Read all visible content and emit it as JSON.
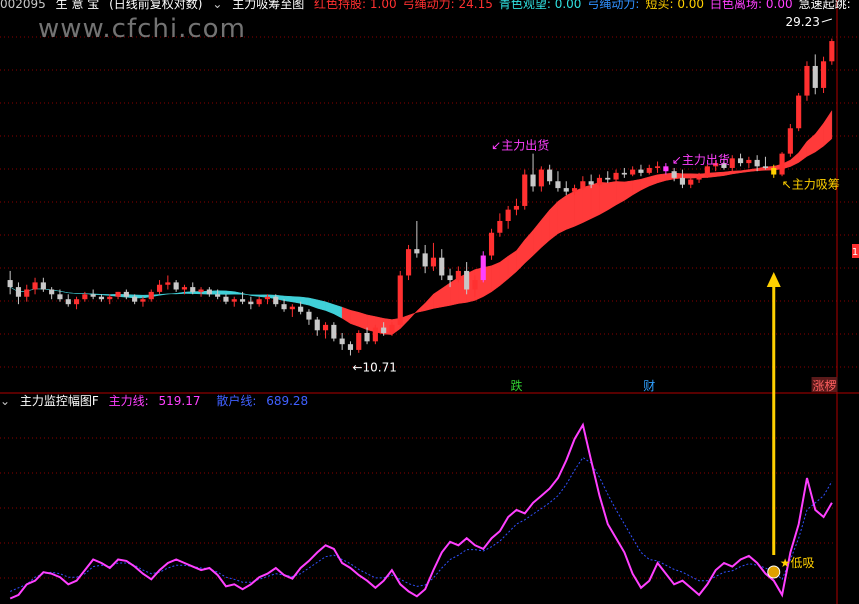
{
  "header": {
    "code": "002095",
    "name": "生 意 宝",
    "mode": "(日线前复权对数)",
    "indicator": "主力吸筹至图",
    "items": [
      {
        "label": "红色持股",
        "value": "1.00",
        "color": "#ff3030"
      },
      {
        "label": "弓绳动力",
        "value": "24.15",
        "color": "#ff3030"
      },
      {
        "label": "青色观望",
        "value": "0.00",
        "color": "#30e0e0"
      },
      {
        "label": "弓绳动力",
        "value": "",
        "color": "#3090ff"
      },
      {
        "label": "短买",
        "value": "0.00",
        "color": "#ffd000"
      },
      {
        "label": "白色离场",
        "value": "0.00",
        "color": "#ff40ff"
      },
      {
        "label": "急速起跳",
        "value": "",
        "color": "#ffffff"
      }
    ]
  },
  "watermark": "www.cfchi.com",
  "sub_header": {
    "title": "主力监控幅图F",
    "line1_label": "主力线:",
    "line1_value": "519.17",
    "line2_label": "散户线:",
    "line2_value": "689.28"
  },
  "annotations": {
    "high_label": "29.23",
    "low_label": "10.71",
    "chuhuo_1": "主力出货",
    "chuhuo_2": "主力出货",
    "xichou": "主力吸筹",
    "dixi": "低吸",
    "right_edge_mark": "1",
    "marker_die": "跌",
    "marker_cai": "财",
    "marker_zhangting": "涨椤"
  },
  "colors": {
    "up": "#ff3030",
    "down": "#c8c8c8",
    "ribbon_red": "#ff3a3a",
    "ribbon_cyan": "#40d0d8",
    "magenta": "#ff40ff",
    "blue_dash": "#3050ff",
    "yellow": "#ffd000",
    "grid": "#8a0000"
  },
  "chart_data": [
    {
      "type": "candlestick",
      "title": "主力吸筹至图",
      "annotations": [
        "29.23",
        "10.71",
        "主力出货",
        "主力出货",
        "主力吸筹"
      ],
      "candles": [
        [
          13.6,
          14.0,
          13.0,
          13.3
        ],
        [
          13.3,
          13.5,
          12.6,
          12.9
        ],
        [
          12.9,
          13.4,
          12.7,
          13.2
        ],
        [
          13.2,
          13.7,
          13.0,
          13.5
        ],
        [
          13.5,
          13.7,
          13.1,
          13.2
        ],
        [
          13.2,
          13.3,
          12.8,
          13.0
        ],
        [
          13.0,
          13.2,
          12.7,
          12.8
        ],
        [
          12.8,
          13.0,
          12.5,
          12.6
        ],
        [
          12.6,
          12.9,
          12.4,
          12.8
        ],
        [
          12.8,
          13.1,
          12.7,
          13.0
        ],
        [
          13.0,
          13.2,
          12.8,
          12.9
        ],
        [
          12.9,
          13.0,
          12.7,
          12.8
        ],
        [
          12.8,
          13.0,
          12.6,
          12.9
        ],
        [
          12.9,
          13.1,
          12.8,
          13.1
        ],
        [
          13.1,
          13.2,
          12.8,
          12.9
        ],
        [
          12.9,
          13.0,
          12.6,
          12.7
        ],
        [
          12.7,
          12.9,
          12.5,
          12.8
        ],
        [
          12.8,
          13.2,
          12.7,
          13.1
        ],
        [
          13.1,
          13.6,
          13.0,
          13.4
        ],
        [
          13.4,
          13.8,
          13.2,
          13.5
        ],
        [
          13.5,
          13.6,
          13.1,
          13.2
        ],
        [
          13.2,
          13.4,
          13.0,
          13.3
        ],
        [
          13.3,
          13.5,
          13.0,
          13.1
        ],
        [
          13.1,
          13.3,
          12.9,
          13.2
        ],
        [
          13.2,
          13.3,
          12.9,
          13.0
        ],
        [
          13.0,
          13.2,
          12.8,
          12.9
        ],
        [
          12.9,
          13.0,
          12.6,
          12.7
        ],
        [
          12.7,
          12.9,
          12.5,
          12.8
        ],
        [
          12.8,
          13.1,
          12.6,
          12.7
        ],
        [
          12.7,
          12.9,
          12.4,
          12.6
        ],
        [
          12.6,
          12.9,
          12.5,
          12.8
        ],
        [
          12.8,
          13.0,
          12.6,
          12.9
        ],
        [
          12.9,
          13.0,
          12.5,
          12.6
        ],
        [
          12.6,
          12.8,
          12.3,
          12.4
        ],
        [
          12.4,
          12.6,
          12.1,
          12.5
        ],
        [
          12.5,
          12.7,
          12.2,
          12.3
        ],
        [
          12.3,
          12.4,
          11.8,
          12.0
        ],
        [
          12.0,
          12.1,
          11.4,
          11.6
        ],
        [
          11.6,
          11.9,
          11.3,
          11.8
        ],
        [
          11.8,
          11.9,
          11.2,
          11.3
        ],
        [
          11.3,
          11.5,
          10.9,
          11.1
        ],
        [
          11.1,
          11.2,
          10.71,
          10.9
        ],
        [
          10.9,
          11.6,
          10.8,
          11.5
        ],
        [
          11.5,
          11.7,
          11.1,
          11.2
        ],
        [
          11.2,
          11.8,
          11.1,
          11.7
        ],
        [
          11.7,
          11.9,
          11.4,
          11.5
        ],
        [
          11.5,
          11.9,
          11.4,
          11.8
        ],
        [
          11.8,
          14.0,
          11.7,
          13.8
        ],
        [
          13.8,
          15.2,
          13.6,
          15.0
        ],
        [
          15.0,
          16.4,
          14.6,
          14.8
        ],
        [
          14.8,
          15.2,
          13.9,
          14.2
        ],
        [
          14.2,
          15.3,
          14.0,
          14.6
        ],
        [
          14.6,
          15.0,
          13.6,
          13.8
        ],
        [
          13.8,
          14.1,
          13.3,
          13.6
        ],
        [
          13.6,
          14.2,
          13.5,
          14.0
        ],
        [
          14.0,
          14.4,
          13.0,
          13.2
        ],
        [
          13.2,
          13.8,
          12.9,
          13.6
        ],
        [
          13.6,
          14.9,
          13.5,
          14.7
        ],
        [
          14.7,
          16.0,
          14.5,
          15.8
        ],
        [
          15.8,
          16.8,
          15.6,
          16.4
        ],
        [
          16.4,
          17.2,
          16.0,
          17.0
        ],
        [
          17.0,
          17.6,
          16.7,
          17.2
        ],
        [
          17.2,
          19.3,
          17.0,
          19.0
        ],
        [
          19.0,
          20.3,
          18.0,
          18.3
        ],
        [
          18.3,
          19.5,
          18.0,
          19.3
        ],
        [
          19.3,
          19.6,
          18.4,
          18.6
        ],
        [
          18.6,
          19.2,
          18.0,
          18.2
        ],
        [
          18.2,
          18.6,
          17.8,
          18.0
        ],
        [
          18.0,
          18.4,
          17.8,
          18.2
        ],
        [
          18.2,
          18.9,
          18.1,
          18.6
        ],
        [
          18.6,
          19.0,
          18.2,
          18.4
        ],
        [
          18.4,
          19.0,
          18.3,
          18.8
        ],
        [
          18.8,
          19.2,
          18.5,
          18.7
        ],
        [
          18.7,
          19.3,
          18.6,
          19.1
        ],
        [
          19.1,
          19.4,
          18.8,
          19.0
        ],
        [
          19.0,
          19.5,
          18.9,
          19.3
        ],
        [
          19.3,
          19.6,
          18.9,
          19.1
        ],
        [
          19.1,
          19.6,
          19.0,
          19.4
        ],
        [
          19.4,
          19.8,
          19.1,
          19.5
        ],
        [
          19.5,
          19.7,
          19.0,
          19.2
        ],
        [
          19.2,
          19.4,
          18.6,
          18.8
        ],
        [
          18.8,
          19.3,
          18.2,
          18.4
        ],
        [
          18.4,
          18.9,
          18.2,
          18.7
        ],
        [
          18.7,
          19.1,
          18.5,
          18.9
        ],
        [
          18.9,
          19.6,
          18.8,
          19.5
        ],
        [
          19.5,
          19.9,
          19.2,
          19.7
        ],
        [
          19.7,
          20.0,
          19.3,
          19.4
        ],
        [
          19.4,
          20.2,
          19.2,
          20.0
        ],
        [
          20.0,
          20.3,
          19.5,
          19.7
        ],
        [
          19.7,
          20.1,
          19.4,
          19.9
        ],
        [
          19.9,
          20.2,
          19.2,
          19.5
        ],
        [
          19.5,
          20.1,
          19.3,
          19.4
        ],
        [
          19.4,
          19.6,
          18.8,
          19.0
        ],
        [
          19.0,
          20.4,
          18.9,
          20.3
        ],
        [
          20.3,
          22.3,
          20.1,
          22.0
        ],
        [
          22.0,
          24.6,
          21.8,
          24.4
        ],
        [
          24.4,
          27.2,
          24.0,
          26.8
        ],
        [
          26.8,
          27.8,
          24.5,
          25.0
        ],
        [
          25.0,
          27.6,
          24.6,
          27.2
        ],
        [
          27.2,
          29.23,
          26.9,
          29.0
        ]
      ],
      "ylim": [
        9.6,
        32
      ]
    },
    {
      "type": "line",
      "title": "主力监控幅图F",
      "annotations": [
        "低吸"
      ],
      "x": [
        0,
        1,
        2,
        3,
        4,
        5,
        6,
        7,
        8,
        9,
        10,
        11,
        12,
        13,
        14,
        15,
        16,
        17,
        18,
        19,
        20,
        21,
        22,
        23,
        24,
        25,
        26,
        27,
        28,
        29,
        30,
        31,
        32,
        33,
        34,
        35,
        36,
        37,
        38,
        39,
        40,
        41,
        42,
        43,
        44,
        45,
        46,
        47,
        48,
        49,
        50,
        51,
        52,
        53,
        54,
        55,
        56,
        57,
        58,
        59,
        60,
        61,
        62,
        63,
        64,
        65,
        66,
        67,
        68,
        69,
        70,
        71,
        72,
        73,
        74,
        75,
        76,
        77,
        78,
        79,
        80,
        81,
        82,
        83,
        84,
        85,
        86,
        87,
        88,
        89,
        90,
        91,
        92,
        93,
        94,
        95,
        96,
        97,
        98,
        99
      ],
      "series": [
        {
          "name": "主力线",
          "values": [
            5,
            10,
            25,
            30,
            42,
            40,
            35,
            25,
            30,
            45,
            60,
            55,
            48,
            60,
            58,
            50,
            40,
            32,
            45,
            55,
            60,
            55,
            50,
            45,
            48,
            38,
            22,
            25,
            18,
            25,
            35,
            40,
            48,
            38,
            33,
            48,
            58,
            70,
            80,
            75,
            55,
            48,
            38,
            30,
            20,
            30,
            45,
            25,
            15,
            8,
            18,
            45,
            70,
            85,
            80,
            90,
            80,
            75,
            90,
            100,
            120,
            130,
            125,
            140,
            150,
            160,
            175,
            200,
            230,
            250,
            200,
            150,
            110,
            90,
            70,
            40,
            20,
            30,
            55,
            40,
            25,
            30,
            20,
            10,
            25,
            45,
            55,
            50,
            60,
            65,
            55,
            40,
            30,
            10,
            70,
            110,
            175,
            130,
            120,
            140
          ]
        },
        {
          "name": "散户线",
          "values": [
            15,
            20,
            25,
            35,
            40,
            42,
            40,
            35,
            35,
            40,
            50,
            52,
            50,
            55,
            55,
            52,
            45,
            40,
            42,
            48,
            52,
            52,
            50,
            48,
            47,
            42,
            35,
            32,
            28,
            28,
            32,
            36,
            40,
            38,
            36,
            40,
            48,
            56,
            64,
            66,
            60,
            54,
            46,
            40,
            34,
            34,
            38,
            32,
            26,
            22,
            24,
            34,
            48,
            60,
            66,
            74,
            74,
            72,
            78,
            86,
            98,
            110,
            116,
            124,
            132,
            140,
            150,
            166,
            186,
            204,
            196,
            176,
            152,
            130,
            110,
            90,
            70,
            60,
            58,
            52,
            46,
            42,
            36,
            30,
            30,
            36,
            42,
            44,
            50,
            54,
            52,
            48,
            42,
            32,
            60,
            90,
            130,
            140,
            150,
            170
          ]
        }
      ]
    }
  ]
}
